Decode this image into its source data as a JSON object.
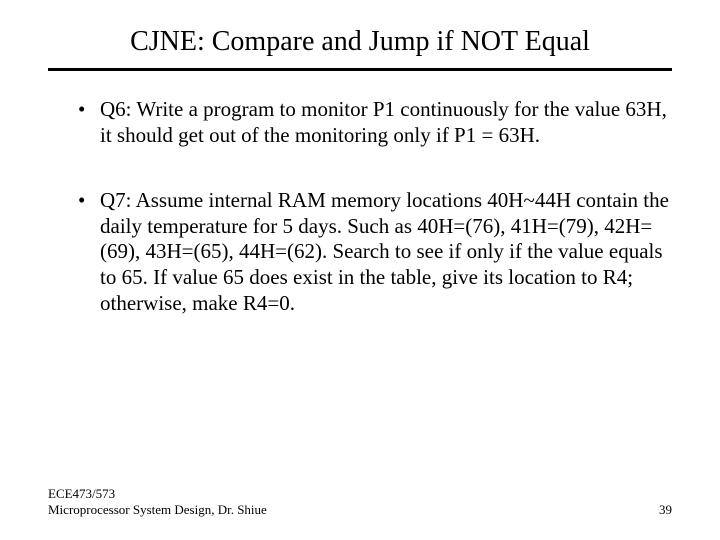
{
  "title": "CJNE: Compare and Jump if NOT Equal",
  "bullets": [
    "Q6: Write a program to monitor P1 continuously for the value 63H, it should get out of the monitoring only if P1 = 63H.",
    "Q7: Assume internal RAM memory locations 40H~44H contain the daily temperature for 5 days. Such as 40H=(76), 41H=(79), 42H=(69), 43H=(65), 44H=(62). Search to see if only if the value equals to 65. If value 65 does exist in the table, give its location to R4; otherwise, make R4=0."
  ],
  "footer": {
    "line1": "ECE473/573",
    "line2": "Microprocessor System Design, Dr. Shiue",
    "page": "39"
  }
}
